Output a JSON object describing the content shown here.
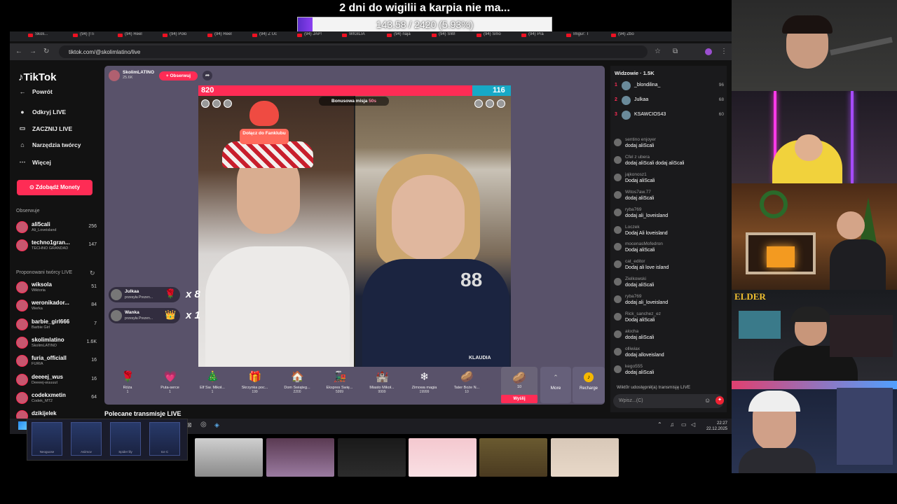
{
  "overlay": {
    "title": "2 dni do wigilii a karpia nie ma...",
    "goal_text": "143.58 / 2420 (5.93%)",
    "goal_fraction": 0.0593
  },
  "browser": {
    "tabs": [
      "Skoli...",
      "(94) [!Ti",
      "(94) Reel",
      "(94) Polo",
      "(94) Reel",
      "(94) Z Uc",
      "(94) JAP!",
      "WIGILIA",
      "(94) naja",
      "(94) SWI",
      "(94) Smo",
      "(94) Pra",
      "Imgur: T",
      "(94) Zbo"
    ],
    "url": "tiktok.com/@skolimlatino/live"
  },
  "sidebar": {
    "logo": "TikTok",
    "nav": [
      {
        "label": "Powrót",
        "icon": "back-arrow-icon"
      },
      {
        "label": "Odkryj LIVE",
        "icon": "live-avatar-icon"
      },
      {
        "label": "ZACZNIJ LIVE",
        "icon": "camera-icon"
      },
      {
        "label": "Narzędzia twórcy",
        "icon": "creator-tools-icon"
      },
      {
        "label": "Więcej",
        "icon": "more-dots-icon"
      }
    ],
    "coins_button": "Zdobądź Monety",
    "following_label": "Obserwuje",
    "following": [
      {
        "name": "ali5cali",
        "sub": "Ali_Loveisland",
        "count": "256"
      },
      {
        "name": "techno1gran...",
        "sub": "TECHNO GRANDAD",
        "count": "147"
      }
    ],
    "suggested_label": "Proponowani twórcy LIVE",
    "suggested": [
      {
        "name": "wiksola",
        "sub": "Wiktoria",
        "count": "51"
      },
      {
        "name": "weronikador...",
        "sub": "Werka",
        "count": "84"
      },
      {
        "name": "barbie_girl666",
        "sub": "Barbie Girl",
        "count": "7"
      },
      {
        "name": "skolimlatino",
        "sub": "SkolimLATINO",
        "count": "1.6K"
      },
      {
        "name": "furia_officiall",
        "sub": "FURIA",
        "count": "16"
      },
      {
        "name": "deeeej_wus",
        "sub": "Deeeej-wuuuut",
        "count": "16"
      },
      {
        "name": "codekxmetin",
        "sub": "Codek_MT2",
        "count": "64"
      },
      {
        "name": "dzikijelek",
        "sub": "",
        "count": ""
      }
    ]
  },
  "stream": {
    "host_name": "SkolimLATINO",
    "host_likes": "25.6K",
    "follow_label": "+ Obserwuj",
    "pk_left": "820",
    "pk_right": "116",
    "pk_left_fraction": 0.876,
    "mission_label": "Bonusowa misja",
    "mission_time": "50s",
    "fanclub_label": "Dołącz do Fanklubu",
    "right_name": "KLAUDIA",
    "gift_notices": [
      {
        "name": "Julkaa",
        "sub": "przesyła Prezen...",
        "mult": "x 8"
      },
      {
        "name": "Wanka",
        "sub": "przesyła Prezen...",
        "mult": "x 1"
      }
    ],
    "gifts": [
      {
        "name": "Róża",
        "price": "1",
        "icon": "rose-icon"
      },
      {
        "name": "Puta-serce",
        "price": "1",
        "icon": "heart-icon"
      },
      {
        "name": "Elf Św. Mikoł...",
        "price": "1",
        "icon": "elf-icon"
      },
      {
        "name": "Skrzynka poc...",
        "price": "199",
        "icon": "box-icon"
      },
      {
        "name": "Dom Świąteg...",
        "price": "2200",
        "icon": "house-icon"
      },
      {
        "name": "Ekspres Świę...",
        "price": "5999",
        "icon": "train-icon"
      },
      {
        "name": "Miasto Mikoł...",
        "price": "9999",
        "icon": "city-icon"
      },
      {
        "name": "Zimowa magia",
        "price": "19999",
        "icon": "snow-icon"
      },
      {
        "name": "Tater Boże N...",
        "price": "10",
        "icon": "potato-icon"
      }
    ],
    "selected_gift_price": "10",
    "send_label": "Wyślij",
    "more_label": "More",
    "recharge_label": "Recharge"
  },
  "recommended_label": "Polecane transmisje LIVE",
  "chat": {
    "viewers_label": "Widzowie · 1.5K",
    "top_viewers": [
      {
        "rank": "1",
        "name": "_blondilina_",
        "count": "96"
      },
      {
        "rank": "2",
        "name": "Julkaa",
        "count": "68"
      },
      {
        "rank": "3",
        "name": "KSAWCIOS43",
        "count": "60"
      }
    ],
    "messages": [
      {
        "user": "sentino enjoyer",
        "text": "dodaj aliScali"
      },
      {
        "user": "Cfel z ubera",
        "text": "dodaj aliScali dodaj aliScali"
      },
      {
        "user": "jajkonosz1",
        "text": "Dodaj aliScali"
      },
      {
        "user": "Witos7aw.77",
        "text": "dodaj aliScali"
      },
      {
        "user": "ryba769",
        "text": "dodaj ali_loveisland"
      },
      {
        "user": "Loczek",
        "text": "Dodaj Ali loveisland"
      },
      {
        "user": "mocenasMofedron",
        "text": "Dodaj aliScali"
      },
      {
        "user": "cat_editor",
        "text": "Dodaj ali love island"
      },
      {
        "user": "Zielkowski",
        "text": "dodaj aliScali"
      },
      {
        "user": "ryba769",
        "text": "dodaj ali_loveisland"
      },
      {
        "user": "Rick_sanchez_ez",
        "text": "Dodaj aliScali"
      },
      {
        "user": "alocha",
        "text": "dodaj aliScali"
      },
      {
        "user": "olliwiax",
        "text": "dodaj alloveisland"
      },
      {
        "user": "kego555",
        "text": "dodaj aliScali"
      }
    ],
    "share_notice": "Wikt0r udostępnił(a) transmisję LIVE",
    "input_placeholder": "Wpisz...(C)"
  },
  "taskbar": {
    "time": "22:27",
    "date": "22.12.2025"
  },
  "skins": [
    "Neoguose",
    "Asiimov",
    "Spider lily",
    "Ice C"
  ],
  "cams": {
    "elder_label": "ELDER"
  }
}
